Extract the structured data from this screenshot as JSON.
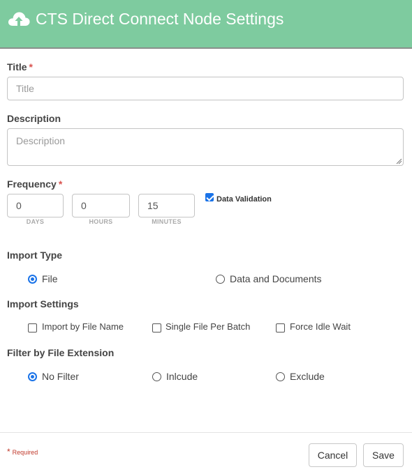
{
  "header": {
    "title": "CTS Direct Connect Node Settings",
    "icon": "cloud-upload-icon",
    "background_color": "#7ecb9f"
  },
  "form": {
    "title": {
      "label": "Title",
      "required_mark": "*",
      "placeholder": "Title",
      "value": ""
    },
    "description": {
      "label": "Description",
      "placeholder": "Description",
      "value": ""
    },
    "frequency": {
      "label": "Frequency",
      "required_mark": "*",
      "days": {
        "value": "0",
        "label": "DAYS"
      },
      "hours": {
        "value": "0",
        "label": "HOURS"
      },
      "minutes": {
        "value": "15",
        "label": "MINUTES"
      },
      "data_validation": {
        "label": "Data Validation",
        "checked": true
      }
    },
    "import_type": {
      "label": "Import Type",
      "options": [
        {
          "label": "File",
          "selected": true
        },
        {
          "label": "Data and Documents",
          "selected": false
        }
      ]
    },
    "import_settings": {
      "label": "Import Settings",
      "options": [
        {
          "label": "Import by File Name",
          "checked": false
        },
        {
          "label": "Single File Per Batch",
          "checked": false
        },
        {
          "label": "Force Idle Wait",
          "checked": false
        }
      ]
    },
    "filter_by_extension": {
      "label": "Filter by File Extension",
      "options": [
        {
          "label": "No Filter",
          "selected": true
        },
        {
          "label": "Inlcude",
          "selected": false
        },
        {
          "label": "Exclude",
          "selected": false
        }
      ]
    }
  },
  "footer": {
    "required_star": "*",
    "required_note": "Required",
    "cancel_label": "Cancel",
    "save_label": "Save"
  },
  "colors": {
    "accent": "#1a73e8",
    "required": "#d9534f"
  }
}
